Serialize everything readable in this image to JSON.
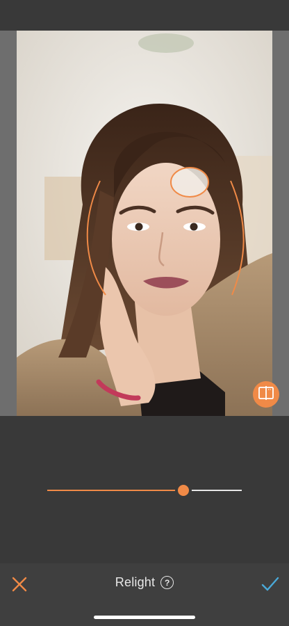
{
  "editor": {
    "photo_description_icon": "portrait-photo",
    "compare_icon": "compare-split-icon"
  },
  "relight": {
    "intensity_percent": 70,
    "accent_color": "#f08a47"
  },
  "toolbar": {
    "cancel_icon": "close-icon",
    "title": "Relight",
    "help_symbol": "?",
    "confirm_icon": "checkmark-icon",
    "confirm_color": "#4aa9d8"
  }
}
